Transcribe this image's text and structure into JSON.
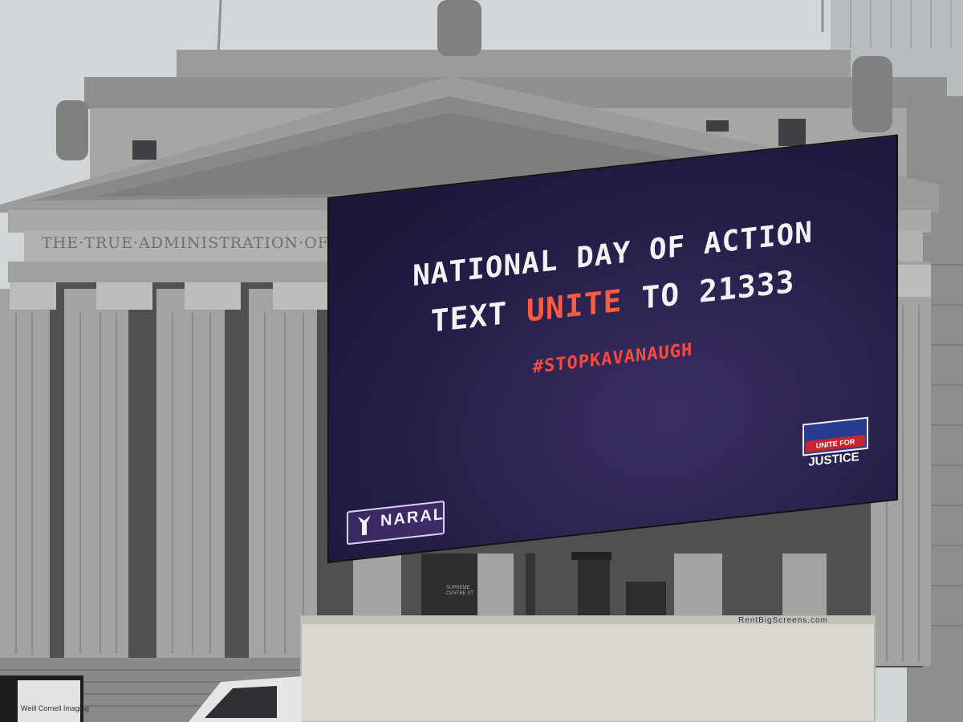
{
  "building": {
    "inscription": "THE·TRUE·ADMINISTRATION·OF·JUSTICE",
    "court_sign_line1": "SUPREME",
    "court_sign_line2": "CENTRE ST"
  },
  "billboard": {
    "line1": "NATIONAL DAY OF ACTION",
    "line2_prefix": "TEXT ",
    "line2_highlight": "UNITE",
    "line2_suffix": " TO 21333",
    "hashtag": "#STOPKAVANAUGH",
    "logo_left": "NARAL",
    "logo_right_badge": "UNITE FOR",
    "logo_right_word": "JUSTICE"
  },
  "truck": {
    "label": "RentBigScreens.com"
  },
  "street_sign": {
    "text": "Weill Cornell Imaging"
  },
  "colors": {
    "sky": "#cfd3d6",
    "stone": "#8d8f8e",
    "screen_bg": "#241c45",
    "screen_highlight": "#ff5a44",
    "truck_box": "#d8d6cf"
  }
}
